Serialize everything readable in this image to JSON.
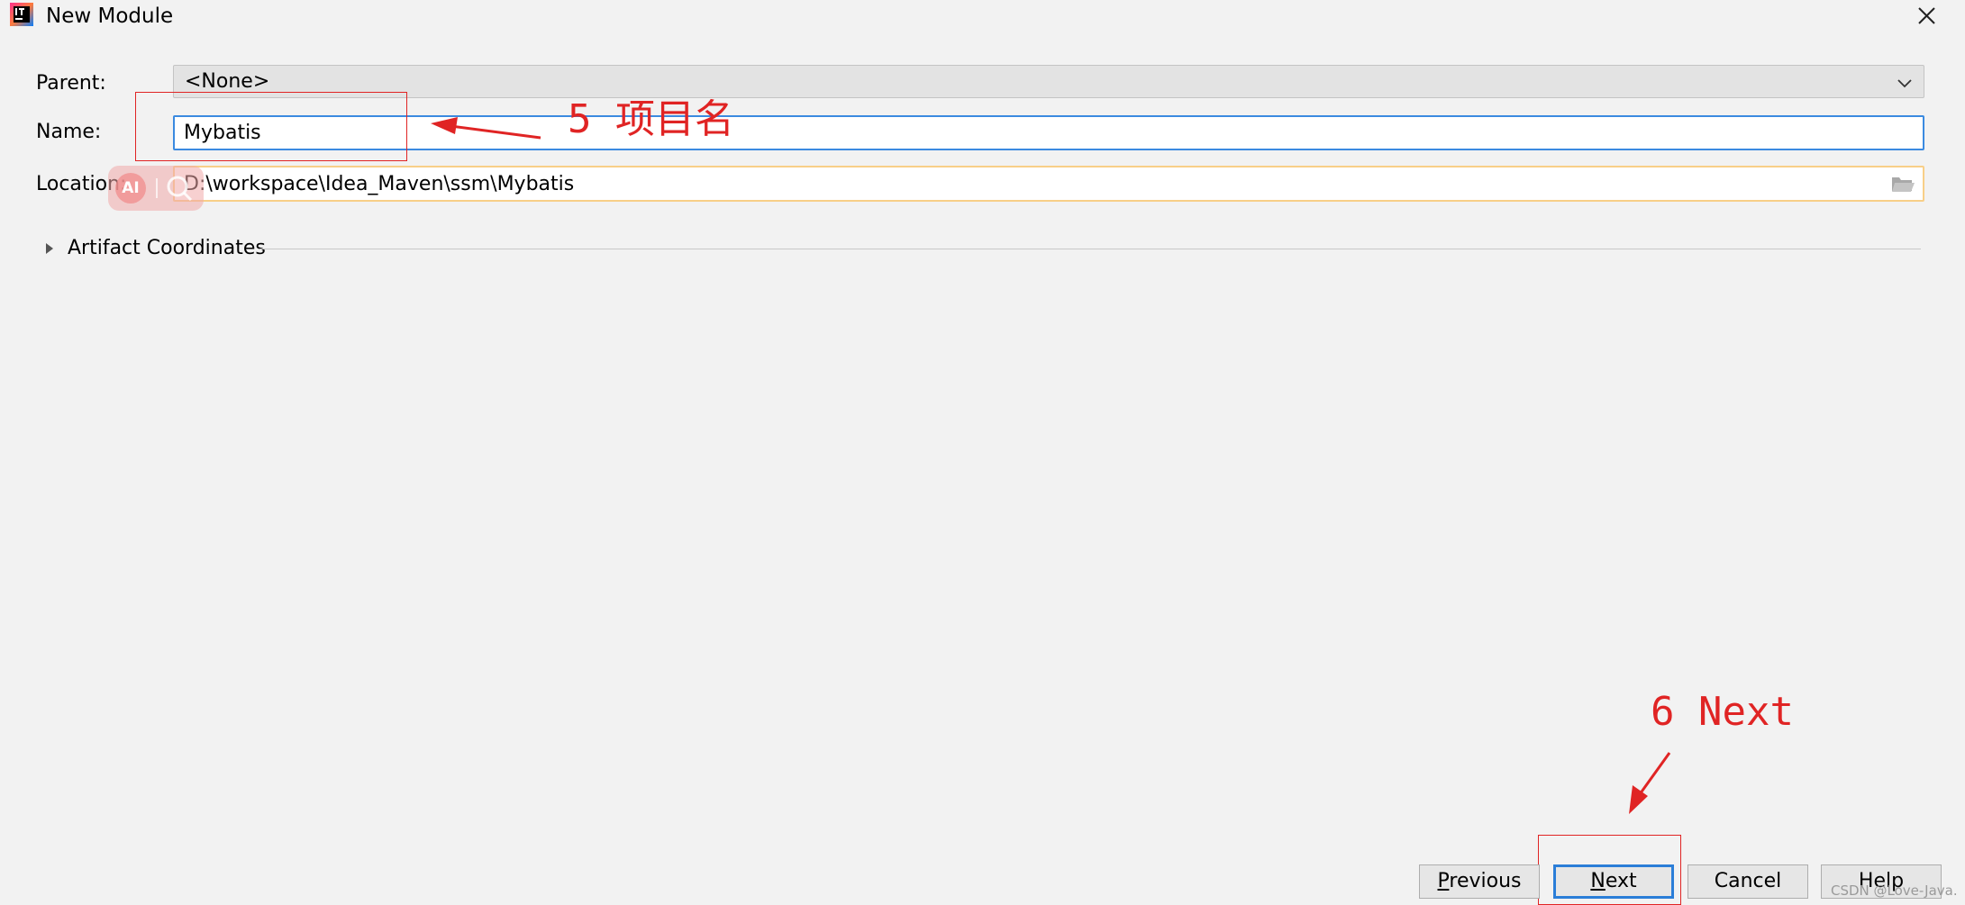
{
  "window": {
    "title": "New Module"
  },
  "form": {
    "parent_label": "Parent:",
    "parent_value": "<None>",
    "name_label": "Name:",
    "name_value": "Mybatis",
    "location_label": "Location:",
    "location_value": "D:\\workspace\\Idea_Maven\\ssm\\Mybatis"
  },
  "artifact": {
    "label": "Artifact Coordinates"
  },
  "ai_widget": {
    "badge": "AI"
  },
  "annotations": {
    "step5": "5 项目名",
    "step6": "6 Next",
    "color": "#e02424"
  },
  "buttons": {
    "previous": {
      "mnemonic": "P",
      "rest": "revious"
    },
    "next": {
      "mnemonic": "N",
      "rest": "ext"
    },
    "cancel": "Cancel",
    "help": "Help"
  },
  "watermark": "CSDN @Love-Java.",
  "colors": {
    "focus_border": "#3b8ae0",
    "warning_border": "#f8cf88",
    "background": "#f2f2f2"
  }
}
